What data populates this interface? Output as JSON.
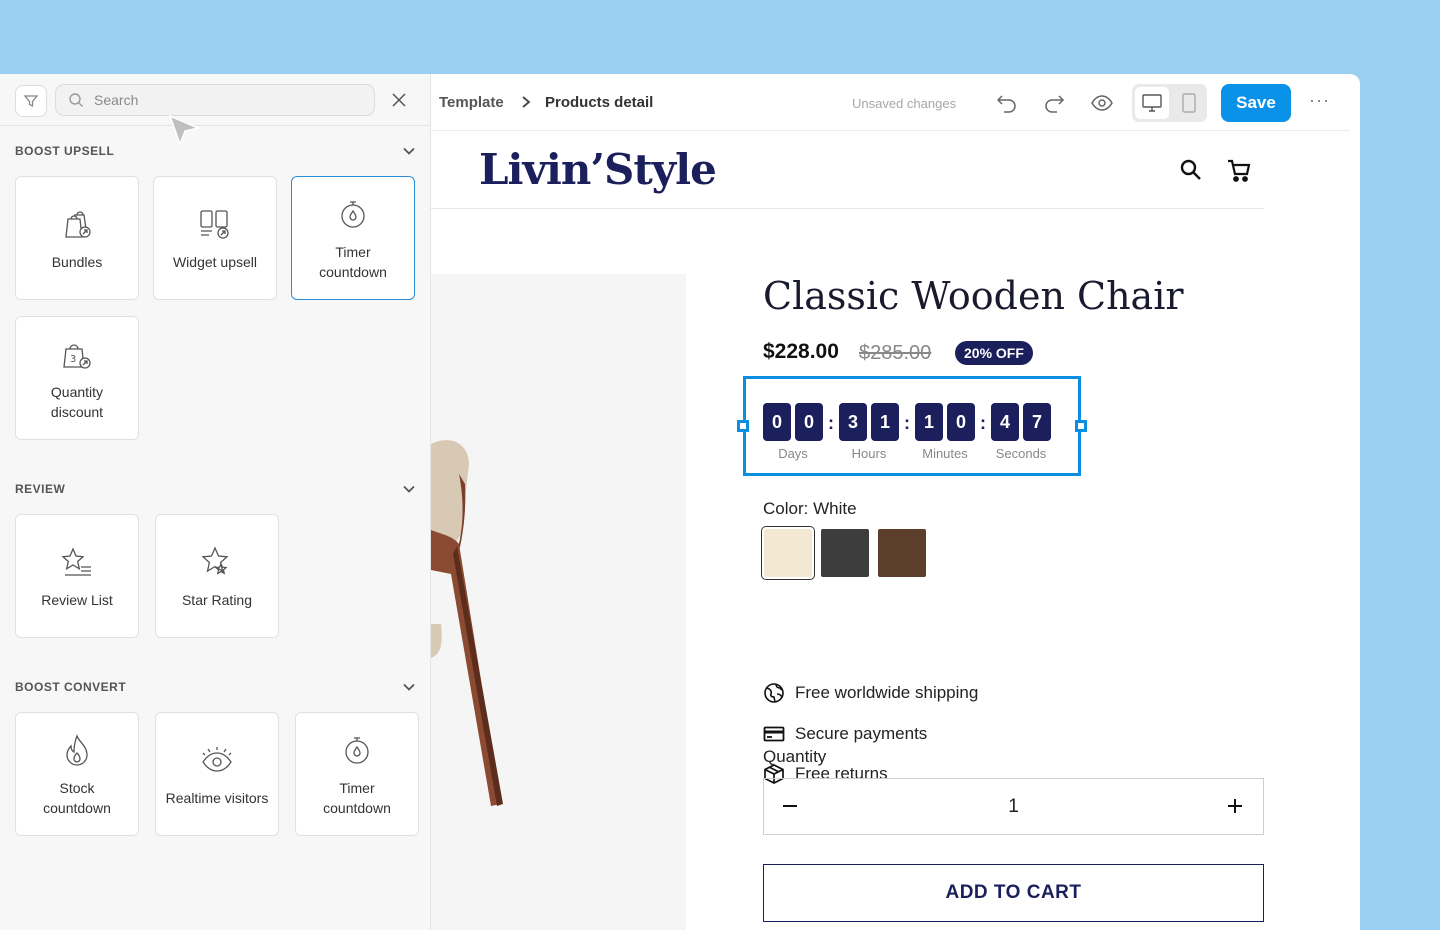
{
  "sidebar": {
    "search_placeholder": "Search",
    "sections": [
      {
        "title": "BOOST UPSELL",
        "items": [
          "Bundles",
          "Widget upsell",
          "Timer countdown",
          "Quantity discount"
        ]
      },
      {
        "title": "REVIEW",
        "items": [
          "Review List",
          "Star Rating"
        ]
      },
      {
        "title": "BOOST CONVERT",
        "items": [
          "Stock countdown",
          "Realtime visitors",
          "Timer countdown"
        ]
      }
    ]
  },
  "topbar": {
    "breadcrumb": [
      "Template",
      "Products detail"
    ],
    "unsaved": "Unsaved changes",
    "save_label": "Save",
    "more": "···"
  },
  "store": {
    "logo": "Livin’Style",
    "product": {
      "title": "Classic Wooden Chair",
      "price": "$228.00",
      "old_price": "$285.00",
      "badge": "20% OFF",
      "timer": {
        "digits": [
          "0",
          "0",
          "3",
          "1",
          "1",
          "0",
          "4",
          "7"
        ],
        "units": [
          "Days",
          "Hours",
          "Minutes",
          "Seconds"
        ]
      },
      "color_label": "Color: White",
      "swatch_colors": [
        "#f3e8d2",
        "#3d3d3d",
        "#5b3e2b"
      ],
      "features": [
        "Free worldwide shipping",
        "Secure payments",
        "Free returns"
      ],
      "quantity_label": "Quantity",
      "quantity_value": "1",
      "add_to_cart": "ADD TO CART"
    }
  },
  "colors": {
    "accent": "#0a91e8",
    "brand": "#1b1f5c",
    "background": "#99cff0"
  }
}
